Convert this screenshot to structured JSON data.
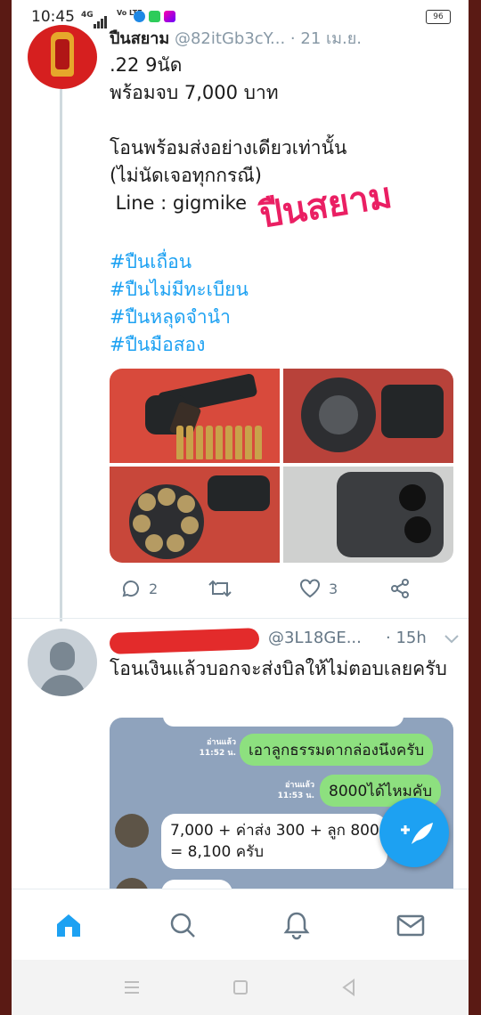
{
  "status_bar": {
    "time": "10:45",
    "network": "4G",
    "volte": "Vo LTE",
    "battery": "96"
  },
  "tweet1": {
    "display_name": "ปืนสยาม",
    "handle": "@82itGb3cY...",
    "date": "· 21 เม.ย.",
    "lines": [
      ".22 9นัด",
      "พร้อมจบ 7,000 บาท",
      "",
      "โอนพร้อมส่งอย่างเดียวเท่านั้น",
      "(ไม่นัดเจอทุกกรณี)",
      " Line : gigmike"
    ],
    "watermark": "ปืนสยาม",
    "hashtags": [
      "#ปืนเถื่อน",
      "#ปืนไม่มีทะเบียน",
      "#ปืนหลุดจำนำ",
      "#ปืนมือสอง"
    ],
    "replies": "2",
    "likes": "3"
  },
  "tweet2": {
    "handle": "@3L18GE...",
    "time": "· 15h",
    "text": "โอนเงินแล้วบอกจะส่งบิลให้ไม่ตอบเลยครับ",
    "chat": {
      "msg1_meta": "อ่านแล้ว\n11:52 น.",
      "msg1": "เอาลูกธรรมดากล่องนึงครับ",
      "msg2_meta": "อ่านแล้ว\n11:53 น.",
      "msg2": "8000ได้ไหมคับ",
      "msg3_line1": "7,000 + ค่าส่ง 300 + ลูก 800",
      "msg3_line2": "= 8,100 ครับ"
    }
  },
  "colors": {
    "accent": "#1da1f2",
    "watermark": "#ea1f63",
    "redaction": "#e32b2b"
  },
  "nav": {
    "items": [
      "home-icon",
      "search-icon",
      "bell-icon",
      "mail-icon"
    ]
  }
}
